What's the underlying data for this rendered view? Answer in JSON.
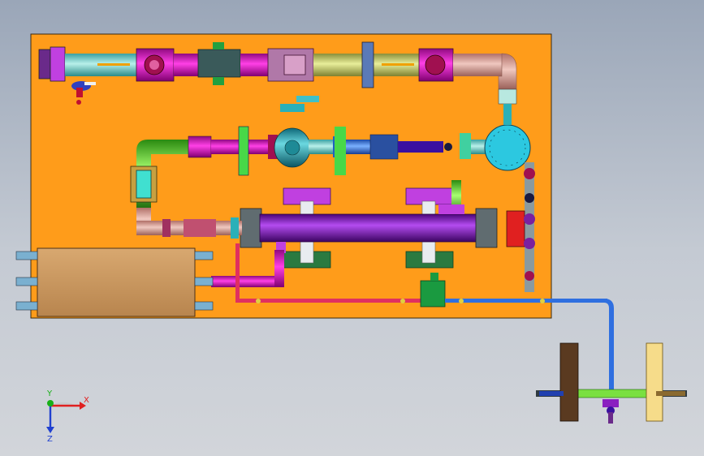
{
  "axes": {
    "x_label": "X",
    "y_label": "Y",
    "z_label": "Z",
    "x_color": "#e02020",
    "y_color": "#18b018",
    "z_color": "#2040d0"
  },
  "colors": {
    "viewport_top": "#9aa6b8",
    "viewport_bottom": "#d2d5da",
    "skid_plate": "#ff9c1a",
    "cabinet": "#c8955e",
    "filter_body": "#8c12c8",
    "pipe_gas": "#cfd86a",
    "pipe_magenta": "#e010c0",
    "pipe_blue": "#2f6fe0",
    "pipe_green": "#55dd22",
    "tank": "#1f9fb0"
  }
}
